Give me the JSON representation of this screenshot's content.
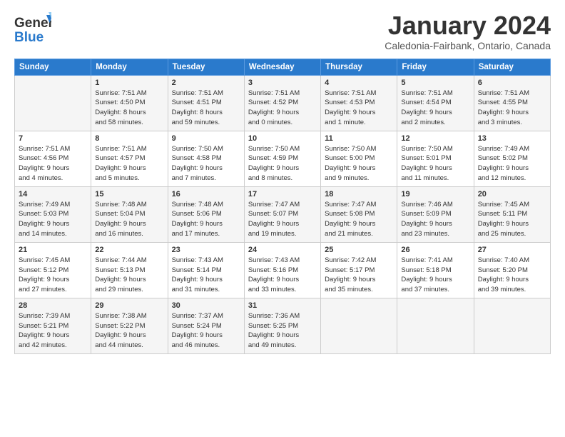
{
  "header": {
    "logo_line1": "General",
    "logo_line2": "Blue",
    "month": "January 2024",
    "location": "Caledonia-Fairbank, Ontario, Canada"
  },
  "days_of_week": [
    "Sunday",
    "Monday",
    "Tuesday",
    "Wednesday",
    "Thursday",
    "Friday",
    "Saturday"
  ],
  "weeks": [
    [
      {
        "day": "",
        "info": ""
      },
      {
        "day": "1",
        "info": "Sunrise: 7:51 AM\nSunset: 4:50 PM\nDaylight: 8 hours\nand 58 minutes."
      },
      {
        "day": "2",
        "info": "Sunrise: 7:51 AM\nSunset: 4:51 PM\nDaylight: 8 hours\nand 59 minutes."
      },
      {
        "day": "3",
        "info": "Sunrise: 7:51 AM\nSunset: 4:52 PM\nDaylight: 9 hours\nand 0 minutes."
      },
      {
        "day": "4",
        "info": "Sunrise: 7:51 AM\nSunset: 4:53 PM\nDaylight: 9 hours\nand 1 minute."
      },
      {
        "day": "5",
        "info": "Sunrise: 7:51 AM\nSunset: 4:54 PM\nDaylight: 9 hours\nand 2 minutes."
      },
      {
        "day": "6",
        "info": "Sunrise: 7:51 AM\nSunset: 4:55 PM\nDaylight: 9 hours\nand 3 minutes."
      }
    ],
    [
      {
        "day": "7",
        "info": "Sunrise: 7:51 AM\nSunset: 4:56 PM\nDaylight: 9 hours\nand 4 minutes."
      },
      {
        "day": "8",
        "info": "Sunrise: 7:51 AM\nSunset: 4:57 PM\nDaylight: 9 hours\nand 5 minutes."
      },
      {
        "day": "9",
        "info": "Sunrise: 7:50 AM\nSunset: 4:58 PM\nDaylight: 9 hours\nand 7 minutes."
      },
      {
        "day": "10",
        "info": "Sunrise: 7:50 AM\nSunset: 4:59 PM\nDaylight: 9 hours\nand 8 minutes."
      },
      {
        "day": "11",
        "info": "Sunrise: 7:50 AM\nSunset: 5:00 PM\nDaylight: 9 hours\nand 9 minutes."
      },
      {
        "day": "12",
        "info": "Sunrise: 7:50 AM\nSunset: 5:01 PM\nDaylight: 9 hours\nand 11 minutes."
      },
      {
        "day": "13",
        "info": "Sunrise: 7:49 AM\nSunset: 5:02 PM\nDaylight: 9 hours\nand 12 minutes."
      }
    ],
    [
      {
        "day": "14",
        "info": "Sunrise: 7:49 AM\nSunset: 5:03 PM\nDaylight: 9 hours\nand 14 minutes."
      },
      {
        "day": "15",
        "info": "Sunrise: 7:48 AM\nSunset: 5:04 PM\nDaylight: 9 hours\nand 16 minutes."
      },
      {
        "day": "16",
        "info": "Sunrise: 7:48 AM\nSunset: 5:06 PM\nDaylight: 9 hours\nand 17 minutes."
      },
      {
        "day": "17",
        "info": "Sunrise: 7:47 AM\nSunset: 5:07 PM\nDaylight: 9 hours\nand 19 minutes."
      },
      {
        "day": "18",
        "info": "Sunrise: 7:47 AM\nSunset: 5:08 PM\nDaylight: 9 hours\nand 21 minutes."
      },
      {
        "day": "19",
        "info": "Sunrise: 7:46 AM\nSunset: 5:09 PM\nDaylight: 9 hours\nand 23 minutes."
      },
      {
        "day": "20",
        "info": "Sunrise: 7:45 AM\nSunset: 5:11 PM\nDaylight: 9 hours\nand 25 minutes."
      }
    ],
    [
      {
        "day": "21",
        "info": "Sunrise: 7:45 AM\nSunset: 5:12 PM\nDaylight: 9 hours\nand 27 minutes."
      },
      {
        "day": "22",
        "info": "Sunrise: 7:44 AM\nSunset: 5:13 PM\nDaylight: 9 hours\nand 29 minutes."
      },
      {
        "day": "23",
        "info": "Sunrise: 7:43 AM\nSunset: 5:14 PM\nDaylight: 9 hours\nand 31 minutes."
      },
      {
        "day": "24",
        "info": "Sunrise: 7:43 AM\nSunset: 5:16 PM\nDaylight: 9 hours\nand 33 minutes."
      },
      {
        "day": "25",
        "info": "Sunrise: 7:42 AM\nSunset: 5:17 PM\nDaylight: 9 hours\nand 35 minutes."
      },
      {
        "day": "26",
        "info": "Sunrise: 7:41 AM\nSunset: 5:18 PM\nDaylight: 9 hours\nand 37 minutes."
      },
      {
        "day": "27",
        "info": "Sunrise: 7:40 AM\nSunset: 5:20 PM\nDaylight: 9 hours\nand 39 minutes."
      }
    ],
    [
      {
        "day": "28",
        "info": "Sunrise: 7:39 AM\nSunset: 5:21 PM\nDaylight: 9 hours\nand 42 minutes."
      },
      {
        "day": "29",
        "info": "Sunrise: 7:38 AM\nSunset: 5:22 PM\nDaylight: 9 hours\nand 44 minutes."
      },
      {
        "day": "30",
        "info": "Sunrise: 7:37 AM\nSunset: 5:24 PM\nDaylight: 9 hours\nand 46 minutes."
      },
      {
        "day": "31",
        "info": "Sunrise: 7:36 AM\nSunset: 5:25 PM\nDaylight: 9 hours\nand 49 minutes."
      },
      {
        "day": "",
        "info": ""
      },
      {
        "day": "",
        "info": ""
      },
      {
        "day": "",
        "info": ""
      }
    ]
  ]
}
